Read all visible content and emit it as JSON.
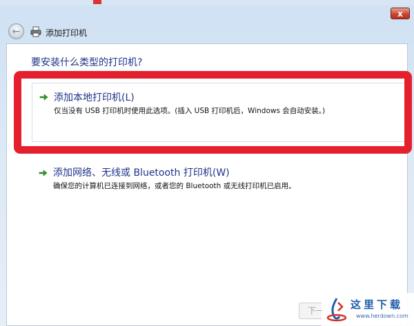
{
  "window": {
    "title": "添加打印机",
    "close_label": "x",
    "back_icon": "back-arrow-icon"
  },
  "content": {
    "question": "要安装什么类型的打印机?",
    "options": [
      {
        "title": "添加本地打印机(L)",
        "description": "仅当没有 USB 打印机时使用此选项。(插入 USB 打印机后，Windows 会自动安装。)"
      },
      {
        "title": "添加网络、无线或 Bluetooth 打印机(W)",
        "description": "确保您的计算机已连接到网络，或者您的 Bluetooth 或无线打印机已启用。"
      }
    ]
  },
  "footer": {
    "next_label": "下一"
  },
  "watermark": {
    "text": "这里下载",
    "url": "www.herdown.com"
  },
  "colors": {
    "accent_link": "#1e3287",
    "highlight_red": "#e5202e",
    "arrow_green": "#2e9e2e"
  }
}
